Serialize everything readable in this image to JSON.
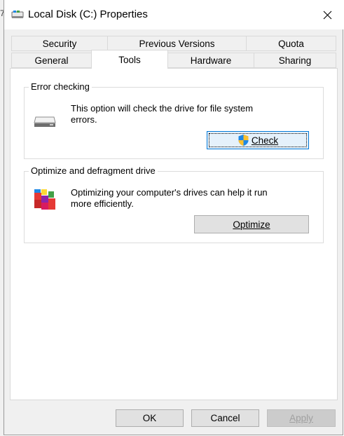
{
  "window": {
    "title": "Local Disk (C:) Properties",
    "left_fragment": "7"
  },
  "tabs": {
    "row_top": [
      "Security",
      "Previous Versions",
      "Quota"
    ],
    "row_bottom": [
      "General",
      "Tools",
      "Hardware",
      "Sharing"
    ],
    "active": "Tools"
  },
  "error_checking": {
    "title": "Error checking",
    "description": "This option will check the drive for file system errors.",
    "button_label": "Check"
  },
  "optimize": {
    "title": "Optimize and defragment drive",
    "description": "Optimizing your computer's drives can help it run more efficiently.",
    "button_label": "Optimize"
  },
  "footer": {
    "ok": "OK",
    "cancel": "Cancel",
    "apply": "Apply"
  },
  "colors": {
    "accent": "#0078d7",
    "button_bg": "#e1e1e1",
    "window_bg": "#f0f0f0"
  }
}
